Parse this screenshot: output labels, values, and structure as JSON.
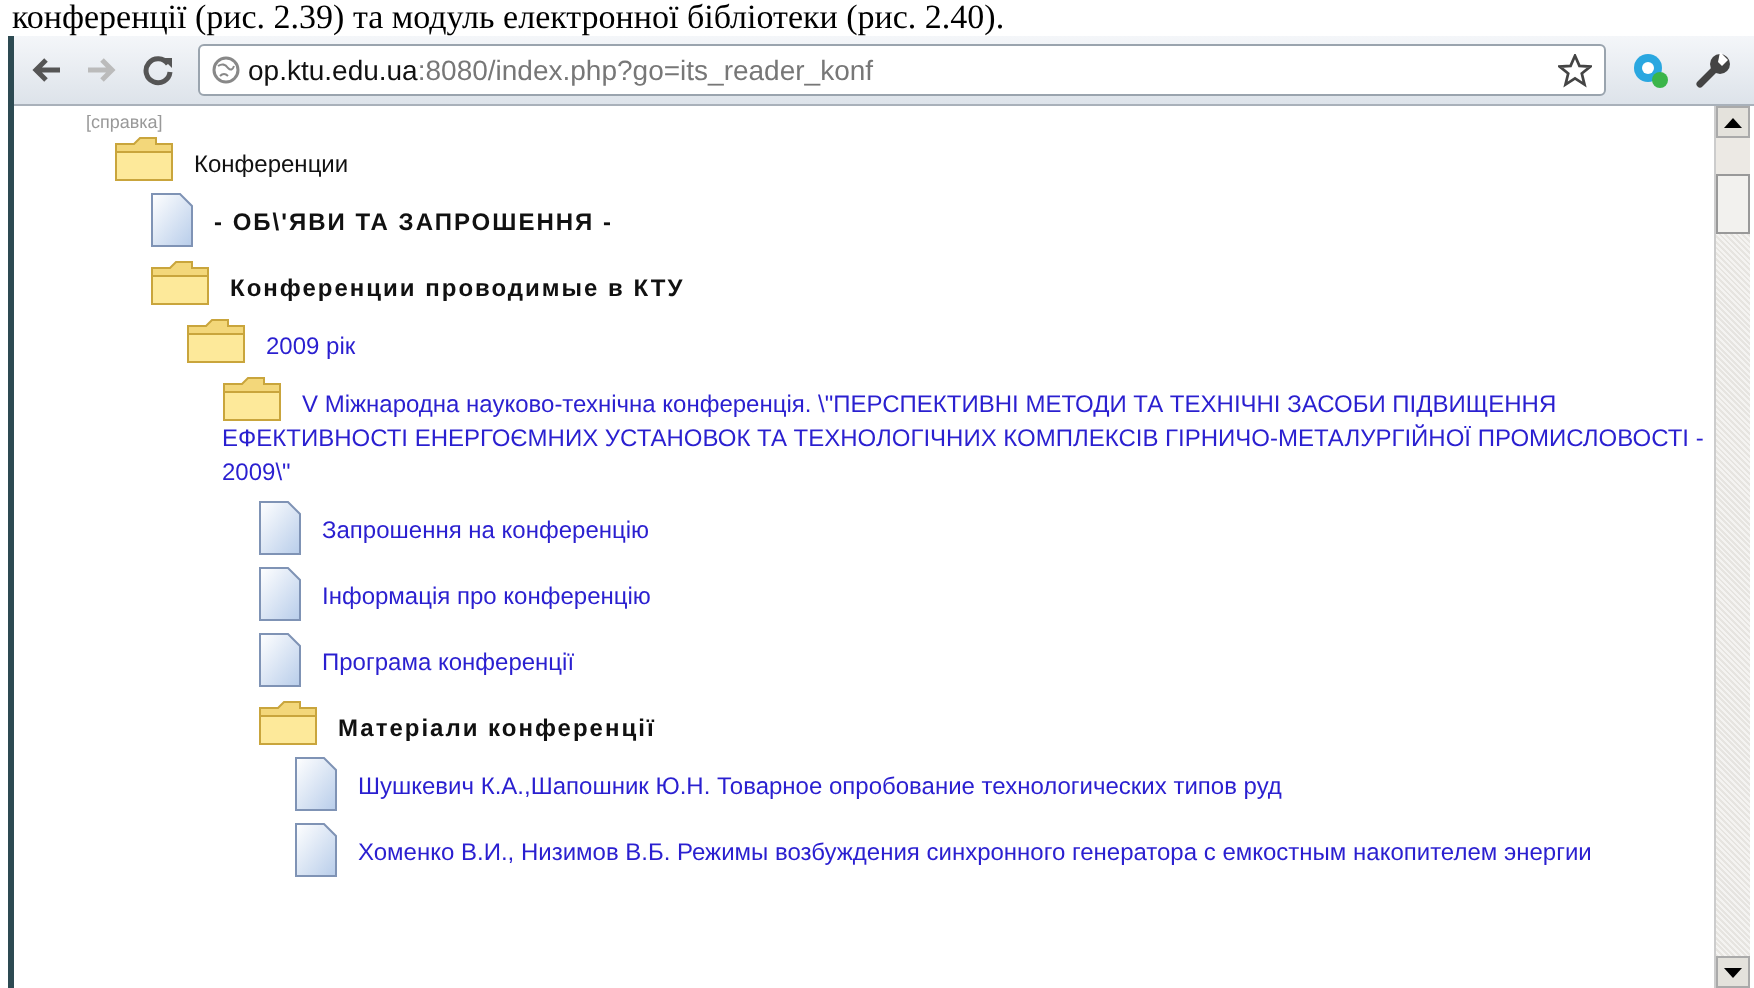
{
  "document_line": "конференції (рис. 2.39) та модуль електронної бібліотеки (рис. 2.40).",
  "browser": {
    "url_host": "op.ktu.edu.ua",
    "url_rest": ":8080/index.php?go=its_reader_konf"
  },
  "page": {
    "help_link": "[справка]",
    "tree": [
      {
        "kind": "folder",
        "label": "Конференции",
        "bold": false,
        "link": false,
        "children": [
          {
            "kind": "page",
            "label": "- ОБ\\'ЯВИ ТА ЗАПРОШЕННЯ -",
            "bold": true,
            "link": false
          },
          {
            "kind": "folder",
            "label": "Конференции проводимые в КТУ",
            "bold": true,
            "link": false,
            "children": [
              {
                "kind": "folder",
                "label": "2009 рік",
                "bold": false,
                "link": true,
                "children": [
                  {
                    "kind": "folder",
                    "label": "V Міжнародна науково-технічна конференція. \\\"ПЕРСПЕКТИВНІ МЕТОДИ ТА ТЕХНІЧНІ ЗАСОБИ ПІДВИЩЕННЯ ЕФЕКТИВНОСТІ ЕНЕРГОЄМНИХ УСТАНОВОК ТА ТЕХНОЛОГІЧНИХ КОМПЛЕКСІВ ГІРНИЧО-МЕТАЛУРГІЙНОЇ ПРОМИСЛОВОСТІ - 2009\\\"",
                    "bold": false,
                    "link": true,
                    "children": [
                      {
                        "kind": "page",
                        "label": "Запрошення на конференцію",
                        "bold": false,
                        "link": true
                      },
                      {
                        "kind": "page",
                        "label": "Інформація про конференцію",
                        "bold": false,
                        "link": true
                      },
                      {
                        "kind": "page",
                        "label": "Програма конференції",
                        "bold": false,
                        "link": true
                      },
                      {
                        "kind": "folder",
                        "label": "Матеріали конференції",
                        "bold": true,
                        "link": false,
                        "children": [
                          {
                            "kind": "page",
                            "label": "Шушкевич К.А.,Шапошник Ю.Н. Товарное опробование технологических типов руд",
                            "bold": false,
                            "link": true
                          },
                          {
                            "kind": "page",
                            "label": "Хоменко В.И., Низимов В.Б. Режимы возбуждения синхронного генератора с емкостным накопителем энергии",
                            "bold": false,
                            "link": true
                          }
                        ]
                      }
                    ]
                  }
                ]
              }
            ]
          }
        ]
      }
    ]
  }
}
